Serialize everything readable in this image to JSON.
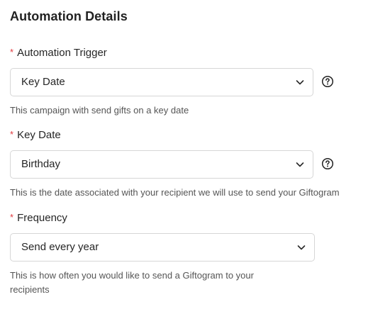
{
  "section": {
    "title": "Automation Details"
  },
  "fields": {
    "trigger": {
      "required_mark": "*",
      "label": "Automation Trigger",
      "value": "Key Date",
      "hint": "This campaign with send gifts on a key date",
      "help_icon": "question-circle-icon"
    },
    "key_date": {
      "required_mark": "*",
      "label": "Key Date",
      "value": "Birthday",
      "hint": "This is the date associated with your recipient we will use to send your Giftogram",
      "help_icon": "question-circle-icon"
    },
    "frequency": {
      "required_mark": "*",
      "label": "Frequency",
      "value": "Send every year",
      "hint_line1": "This is how often you would like to send a Giftogram to your",
      "hint_line2": "recipients"
    }
  },
  "colors": {
    "required": "#e0393e",
    "border": "#d6d6d6",
    "hint_text": "#555555"
  }
}
